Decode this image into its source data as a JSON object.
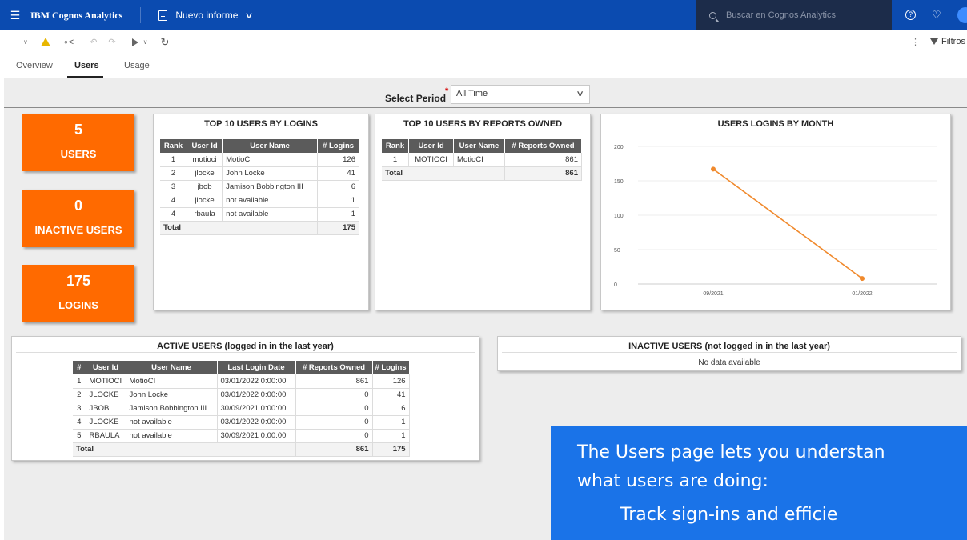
{
  "app": {
    "brand": "IBM Cognos Analytics",
    "report_title": "Nuevo informe",
    "search_placeholder": "Buscar en Cognos Analytics"
  },
  "toolbar": {
    "filter_label": "Filtros"
  },
  "tabs": [
    {
      "label": "Overview"
    },
    {
      "label": "Users",
      "active": true
    },
    {
      "label": "Usage"
    }
  ],
  "period": {
    "label": "Select Period",
    "required_mark": "*",
    "selected": "All Time"
  },
  "kpis": [
    {
      "value": "5",
      "label": "USERS"
    },
    {
      "value": "0",
      "label": "INACTIVE USERS"
    },
    {
      "value": "175",
      "label": "LOGINS"
    }
  ],
  "top_logins": {
    "title": "TOP 10 USERS BY LOGINS",
    "columns": [
      "Rank",
      "User Id",
      "User Name",
      "# Logins"
    ],
    "rows": [
      [
        "1",
        "motioci",
        "MotioCI",
        "126"
      ],
      [
        "2",
        "jlocke",
        "John Locke",
        "41"
      ],
      [
        "3",
        "jbob",
        "Jamison Bobbington III",
        "6"
      ],
      [
        "4",
        "jlocke",
        "not available",
        "1"
      ],
      [
        "4",
        "rbaula",
        "not available",
        "1"
      ]
    ],
    "total_label": "Total",
    "total_value": "175"
  },
  "top_reports": {
    "title": "TOP 10 USERS BY REPORTS OWNED",
    "columns": [
      "Rank",
      "User Id",
      "User Name",
      "# Reports Owned"
    ],
    "rows": [
      [
        "1",
        "MOTIOCI",
        "MotioCI",
        "861"
      ]
    ],
    "total_label": "Total",
    "total_value": "861"
  },
  "logins_chart": {
    "title": "USERS LOGINS BY MONTH"
  },
  "chart_data": {
    "type": "line",
    "title": "USERS LOGINS BY MONTH",
    "categories": [
      "09/2021",
      "01/2022"
    ],
    "values": [
      167,
      8
    ],
    "ylim": [
      0,
      200
    ],
    "yticks": [
      0,
      50,
      100,
      150,
      200
    ],
    "grid": true,
    "line_color": "#f0892c"
  },
  "active_users": {
    "title": "ACTIVE USERS (logged in in the last year)",
    "columns": [
      "#",
      "User Id",
      "User Name",
      "Last Login Date",
      "# Reports Owned",
      "# Logins"
    ],
    "rows": [
      [
        "1",
        "MOTIOCI",
        "MotioCI",
        "03/01/2022 0:00:00",
        "861",
        "126"
      ],
      [
        "2",
        "JLOCKE",
        "John Locke",
        "03/01/2022 0:00:00",
        "0",
        "41"
      ],
      [
        "3",
        "JBOB",
        "Jamison Bobbington III",
        "30/09/2021 0:00:00",
        "0",
        "6"
      ],
      [
        "4",
        "JLOCKE",
        "not available",
        "03/01/2022 0:00:00",
        "0",
        "1"
      ],
      [
        "5",
        "RBAULA",
        "not available",
        "30/09/2021 0:00:00",
        "0",
        "1"
      ]
    ],
    "total_label": "Total",
    "total_reports": "861",
    "total_logins": "175"
  },
  "inactive_users": {
    "title": "INACTIVE USERS (not logged in in the last year)",
    "empty_text": "No data available"
  },
  "callout": {
    "line1": "The Users page lets you understan",
    "line2": "what users are doing:",
    "line3": "Track sign-ins and efficie"
  },
  "colors": {
    "header_blue": "#0b4bb0",
    "kpi_orange": "#ff6a00",
    "callout_blue": "#1a73e8"
  }
}
